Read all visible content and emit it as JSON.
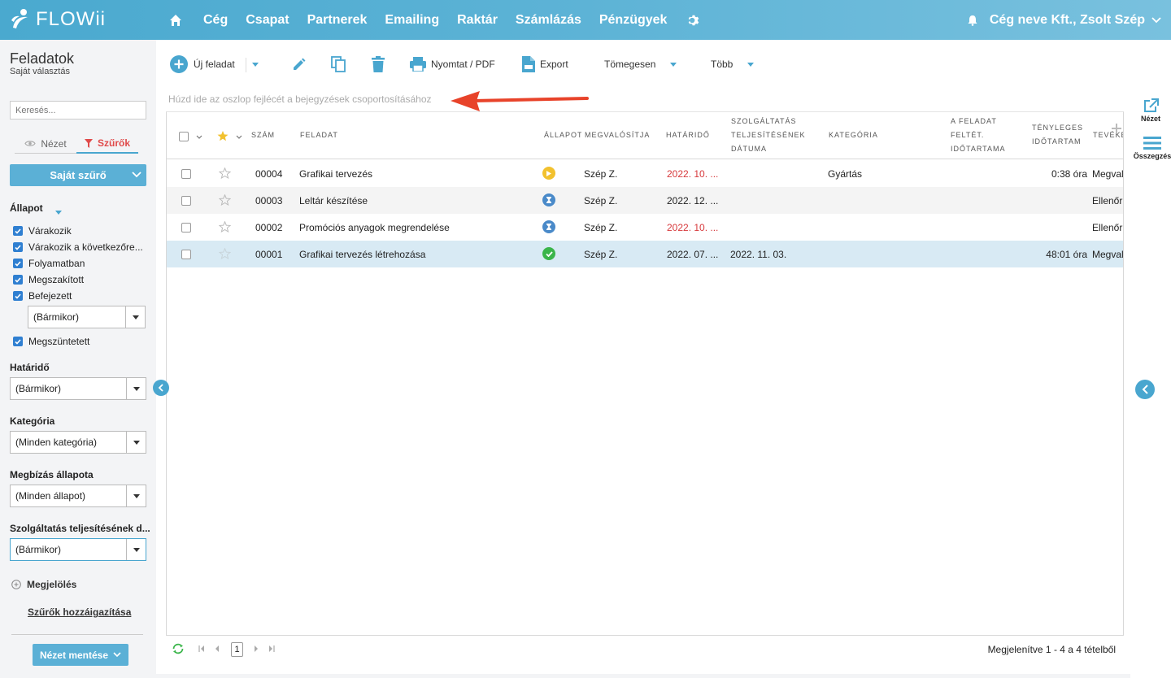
{
  "app": {
    "logo": "FLOWii"
  },
  "nav": {
    "items": [
      "Cég",
      "Csapat",
      "Partnerek",
      "Emailing",
      "Raktár",
      "Számlázás",
      "Pénzügyek"
    ],
    "company": "Cég neve Kft., Zsolt Szép"
  },
  "sidebar": {
    "title": "Feladatok",
    "subtitle": "Saját választás",
    "search_placeholder": "Keresés...",
    "tab_view": "Nézet",
    "tab_filters": "Szűrők",
    "own_filter": "Saját szűrő",
    "status_label": "Állapot",
    "statuses": [
      "Várakozik",
      "Várakozik a következőre...",
      "Folyamatban",
      "Megszakított",
      "Befejezett"
    ],
    "finished_when": "(Bármikor)",
    "cancelled": "Megszüntetett",
    "deadline_label": "Határidő",
    "deadline_value": "(Bármikor)",
    "category_label": "Kategória",
    "category_value": "(Minden kategória)",
    "assignment_label": "Megbízás állapota",
    "assignment_value": "(Minden állapot)",
    "service_label": "Szolgáltatás teljesítésének d...",
    "service_value": "(Bármikor)",
    "mark": "Megjelölés",
    "assign_filters": "Szűrők hozzáigazítása",
    "save_view": "Nézet mentése"
  },
  "toolbar": {
    "new_task": "Új feladat",
    "print": "Nyomtat / PDF",
    "export": "Export",
    "bulk": "Tömegesen",
    "more": "Több"
  },
  "grid": {
    "group_hint": "Húzd ide az oszlop fejlécét a bejegyzések csoportosításához",
    "headers": {
      "number": "SZÁM",
      "task": "FELADAT",
      "status": "ÁLLAPOT",
      "assignee": "MEGVALÓSÍTJA",
      "deadline": "HATÁRIDŐ",
      "service_l1": "SZOLGÁLTATÁS",
      "service_l2": "TELJESÍTÉSÉNEK",
      "service_l3": "DÁTUMA",
      "category": "KATEGÓRIA",
      "duration_l1": "A FELADAT",
      "duration_l2": "FELTÉT.",
      "duration_l3": "IDŐTARTAMA",
      "actual_l1": "TÉNYLEGES",
      "actual_l2": "IDŐTARTAM",
      "activity": "TEVÉKE"
    },
    "rows": [
      {
        "number": "00004",
        "task": "Grafikai tervezés",
        "status": "in-progress",
        "assignee": "Szép Z.",
        "deadline": "2022. 10. ...",
        "deadline_overdue": true,
        "service_date": "",
        "category": "Gyártás",
        "actual": "0:38 óra",
        "activity": "Megval"
      },
      {
        "number": "00003",
        "task": "Leltár készítése",
        "status": "waiting",
        "assignee": "Szép Z.",
        "deadline": "2022. 12. ...",
        "deadline_overdue": false,
        "service_date": "",
        "category": "",
        "actual": "",
        "activity": "Ellenőr"
      },
      {
        "number": "00002",
        "task": "Promóciós anyagok megrendelése",
        "status": "waiting",
        "assignee": "Szép Z.",
        "deadline": "2022. 10. ...",
        "deadline_overdue": true,
        "service_date": "",
        "category": "",
        "actual": "",
        "activity": "Ellenőr"
      },
      {
        "number": "00001",
        "task": "Grafikai tervezés létrehozása",
        "status": "done",
        "assignee": "Szép Z.",
        "deadline": "2022. 07. ...",
        "deadline_overdue": false,
        "service_date": "2022. 11. 03.",
        "category": "",
        "actual": "48:01 óra",
        "activity": "Megval"
      }
    ]
  },
  "pager": {
    "page": "1",
    "info": "Megjelenítve 1 - 4 a 4 tételből"
  },
  "rail": {
    "view": "Nézet",
    "summary": "Összegzés"
  },
  "colors": {
    "accent": "#49a6cf",
    "overdue": "#d7383b",
    "in_progress": "#f2c12e",
    "waiting": "#4a8ac9",
    "done": "#3ab54a"
  }
}
